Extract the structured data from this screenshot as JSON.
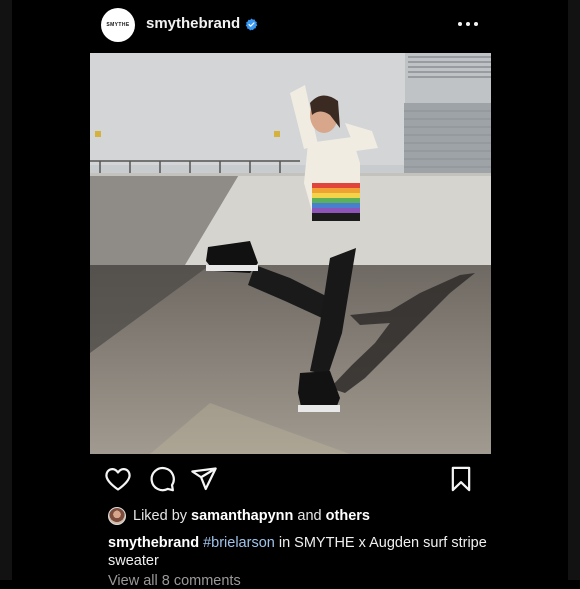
{
  "header": {
    "avatar_text": "SMYTHE",
    "username": "smythebrand",
    "verified": true,
    "verified_color": "#3897f0"
  },
  "post": {
    "image_alt": "Woman in rainbow stripe sweater kicking one leg up in a parking lot"
  },
  "actions": {
    "icons": [
      "heart-icon",
      "comment-icon",
      "share-icon",
      "bookmark-icon"
    ]
  },
  "likes": {
    "prefix": "Liked by",
    "user": "samanthapynn",
    "conjunction": "and",
    "others": "others"
  },
  "caption": {
    "username": "smythebrand",
    "hashtag": "#brielarson",
    "text": " in SMYTHE x Augden surf stripe sweater"
  },
  "comments": {
    "link_text": "View all 8 comments"
  }
}
